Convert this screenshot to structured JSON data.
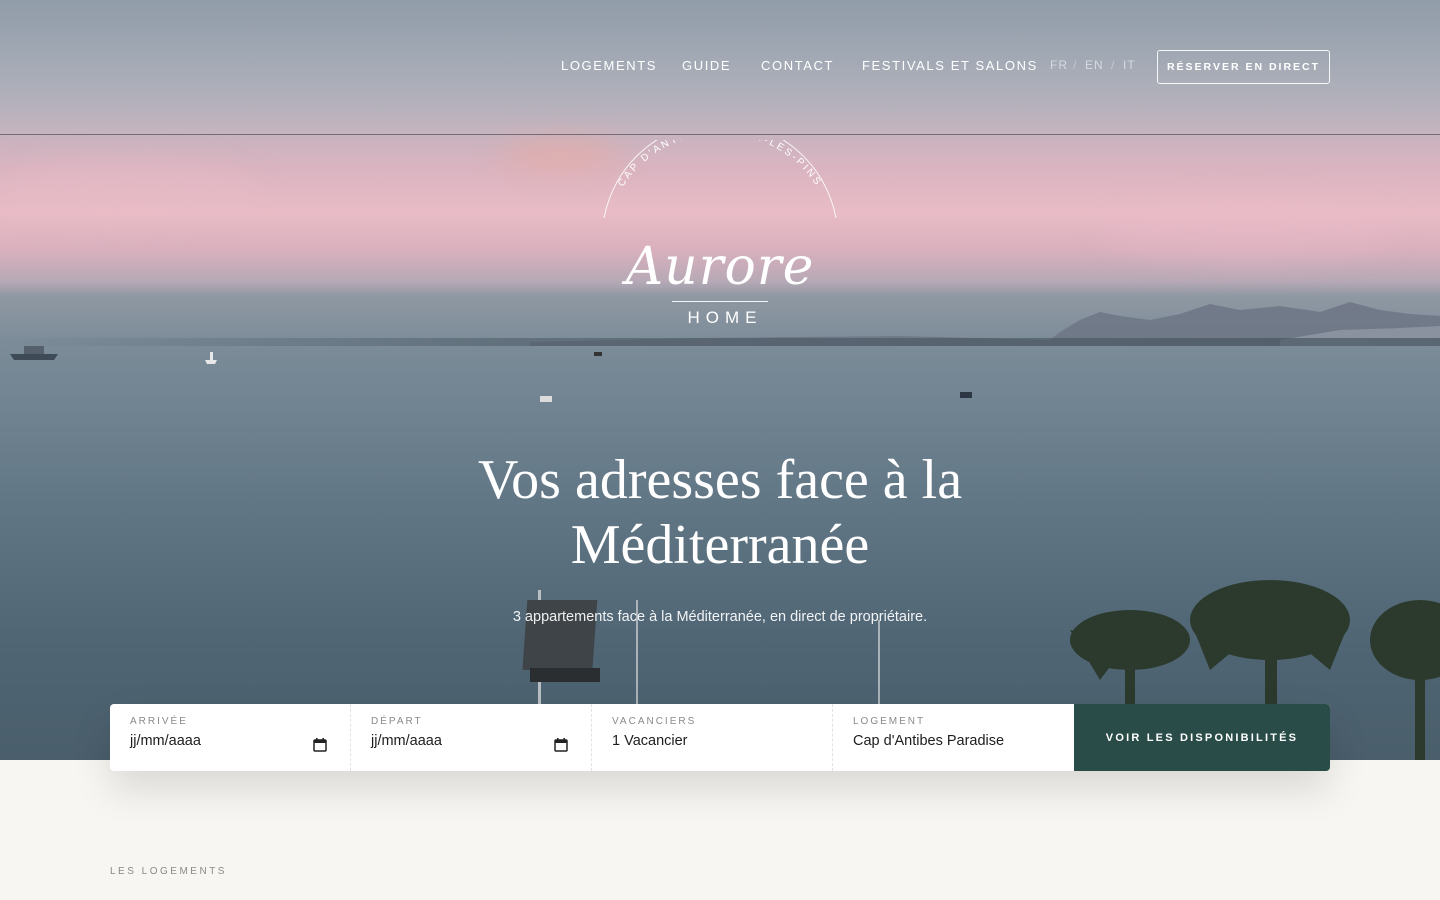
{
  "nav": {
    "links": [
      "LOGEMENTS",
      "GUIDE",
      "CONTACT",
      "FESTIVALS ET SALONS"
    ],
    "languages": [
      "FR",
      "EN",
      "IT"
    ],
    "lang_separator": "/",
    "reserve_label": "RÉSERVER EN DIRECT"
  },
  "logo": {
    "arc_text": "CAP D'ANTIBES · JUAN-LES-PINS",
    "script": "Aurore",
    "subtitle": "HOME"
  },
  "hero": {
    "headline_line1": "Vos adresses face à la",
    "headline_line2": "Méditerranée",
    "subline": "3 appartements face à la Méditerranée, en direct de propriétaire."
  },
  "booking": {
    "arrival_label": "ARRIVÉE",
    "arrival_value": "jj/mm/aaaa",
    "departure_label": "DÉPART",
    "departure_value": "jj/mm/aaaa",
    "guests_label": "VACANCIERS",
    "guests_value": "1 Vacancier",
    "lodging_label": "LOGEMENT",
    "lodging_value": "Cap d'Antibes Paradise",
    "submit_label": "VOIR LES DISPONIBILITÉS"
  },
  "section": {
    "label": "LES LOGEMENTS"
  },
  "colors": {
    "accent": "#2a4c48",
    "page_background": "#f7f6f2"
  },
  "icons": [
    "calendar-icon",
    "calendar-icon"
  ]
}
